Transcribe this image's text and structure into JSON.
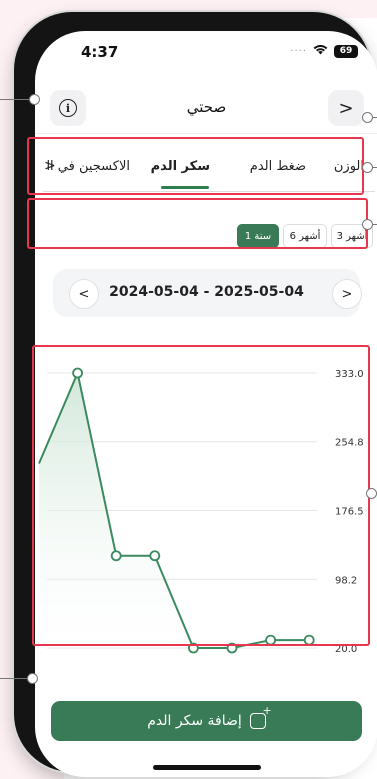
{
  "status_bar": {
    "time": "4:37",
    "battery": "69"
  },
  "nav": {
    "title": "صحتي",
    "info_icon": "info-icon",
    "back_icon": "chevron-right-icon",
    "info_glyph": "i",
    "back_glyph": ">"
  },
  "tabs": [
    {
      "label": "الوزن",
      "active": false
    },
    {
      "label": "ضغط الدم",
      "active": false
    },
    {
      "label": "سكر الدم",
      "active": true
    },
    {
      "label": "الاكسجين في اا",
      "active": false
    }
  ],
  "tabs_scroll_glyph": "<",
  "periods": [
    {
      "label": "3 أشهر",
      "active": false
    },
    {
      "label": "6 أشهر",
      "active": false
    },
    {
      "label": "1 سنة",
      "active": true
    }
  ],
  "date_nav": {
    "range": "2024-05-04 - 2025-05-04",
    "prev_glyph": "<",
    "next_glyph": ">"
  },
  "chart_data": {
    "type": "area",
    "ylim": [
      20.0,
      333.0
    ],
    "y_ticks": [
      "333.0",
      "254.8",
      "176.5",
      "98.2",
      "20.0"
    ],
    "y_tick_values": [
      333.0,
      254.8,
      176.5,
      98.2,
      20.0
    ],
    "series": [
      {
        "values": [
          230,
          333,
          125,
          125,
          20,
          20,
          29,
          29
        ]
      }
    ],
    "line_color": "#3b8a5e",
    "fill_color": "#cfe6d8",
    "grid": true
  },
  "add_button": {
    "label": "إضافة سكر الدم"
  },
  "colors": {
    "accent": "#3a7b57",
    "annotation": "#e8364e"
  }
}
